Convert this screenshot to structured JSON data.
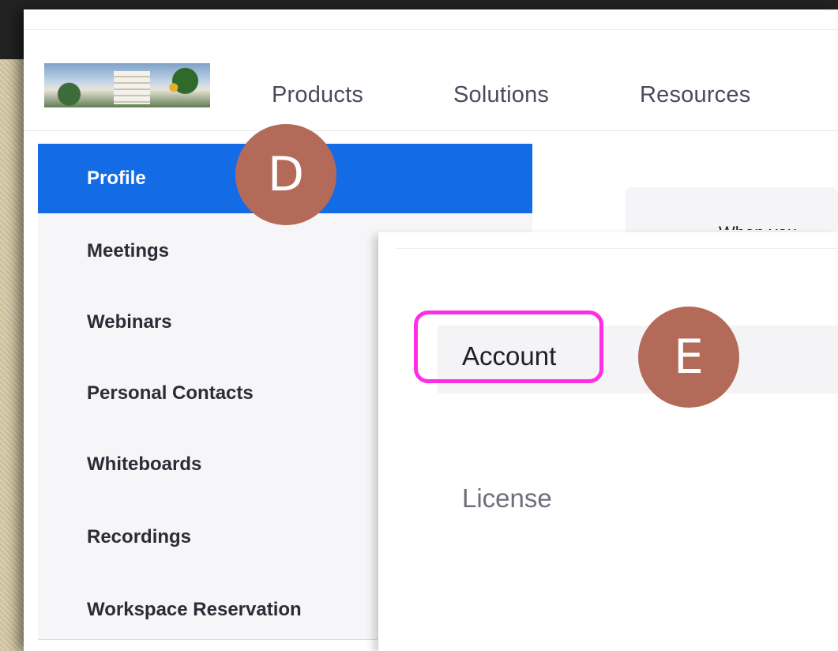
{
  "nav": {
    "links": [
      "Products",
      "Solutions",
      "Resources"
    ]
  },
  "sidebar": {
    "items": [
      {
        "label": "Profile",
        "active": true
      },
      {
        "label": "Meetings"
      },
      {
        "label": "Webinars"
      },
      {
        "label": "Personal Contacts"
      },
      {
        "label": "Whiteboards"
      },
      {
        "label": "Recordings"
      },
      {
        "label": "Workspace Reservation"
      }
    ]
  },
  "content": {
    "partial_text": "When you"
  },
  "dropdown": {
    "items": [
      "Account",
      "License"
    ]
  },
  "annotations": {
    "marker_d": "D",
    "marker_e": "E",
    "highlight_color": "#ff2ee6",
    "marker_color": "#b36a58"
  },
  "colors": {
    "accent": "#136ce6"
  }
}
